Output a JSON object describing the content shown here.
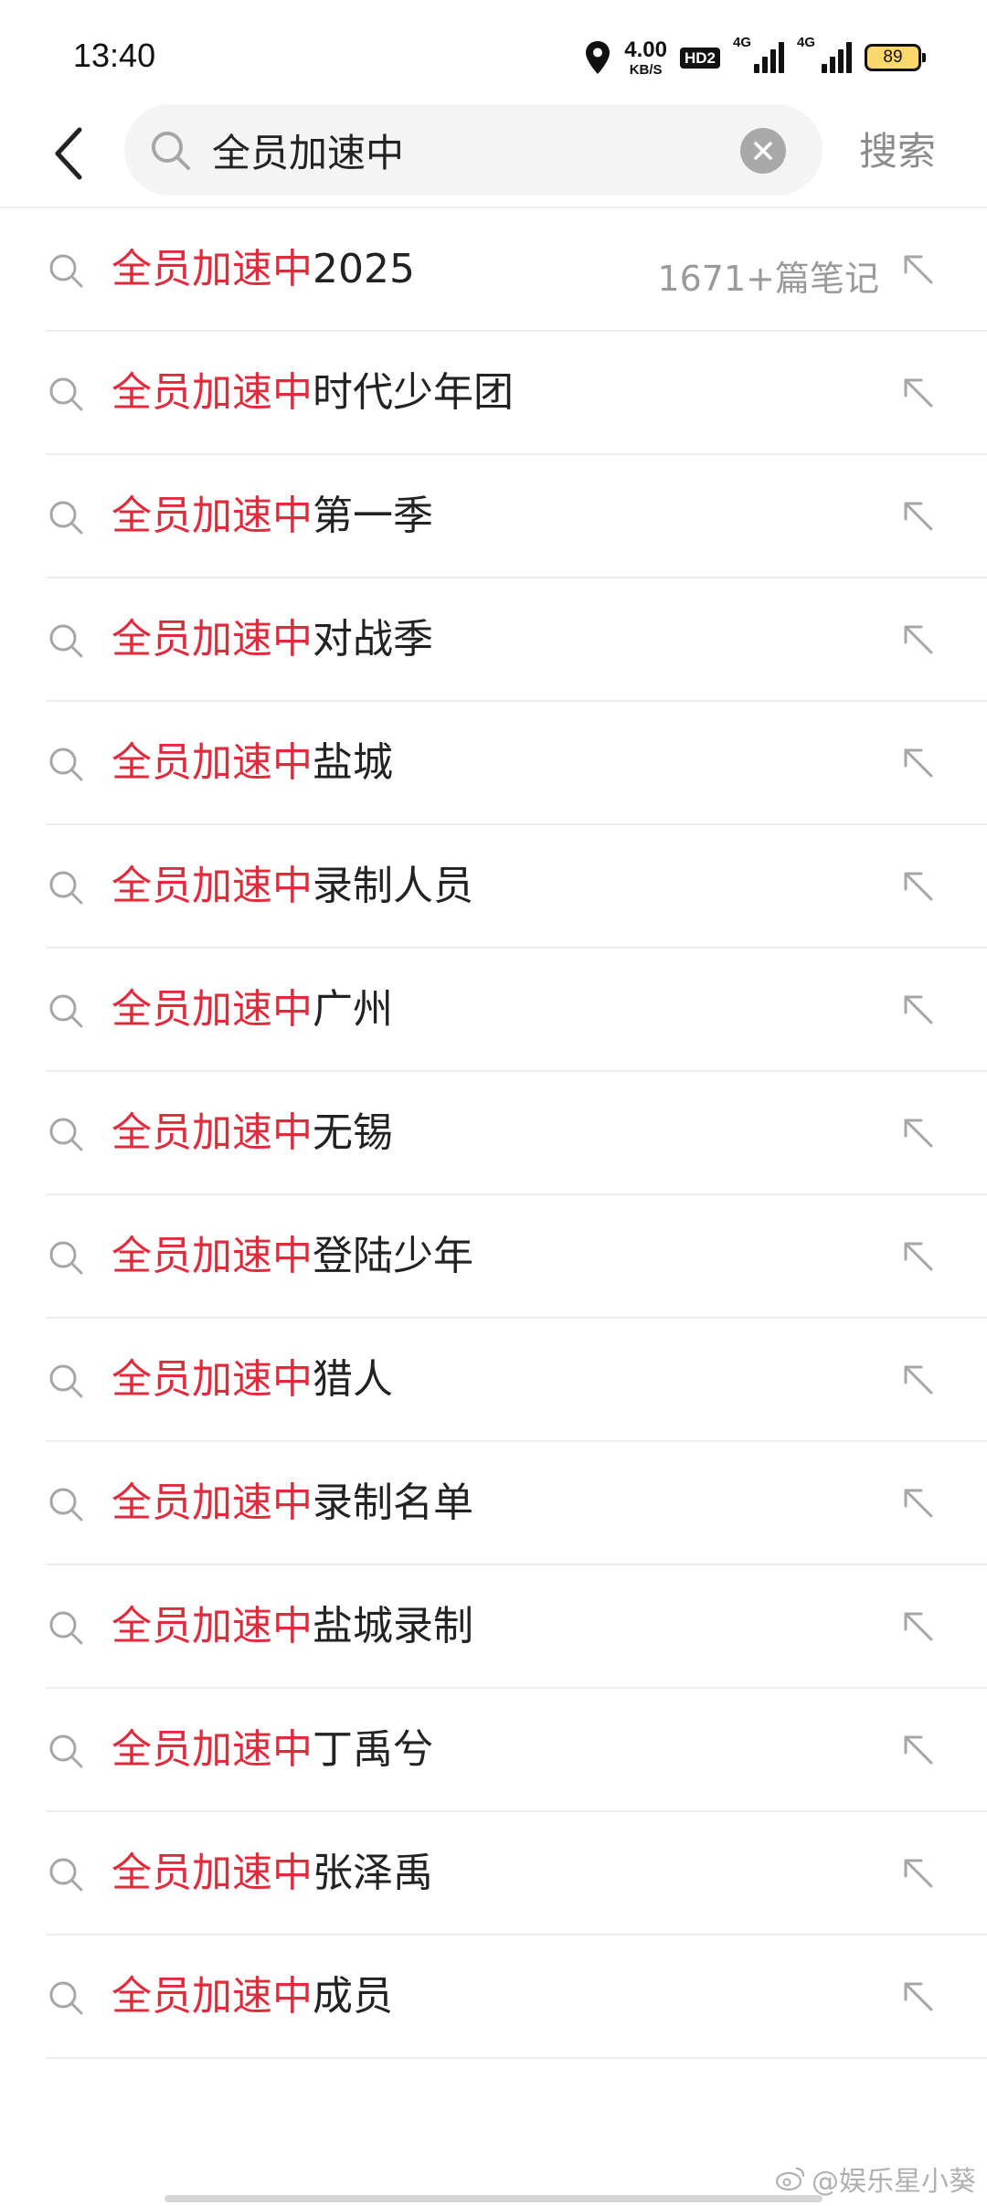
{
  "status_bar": {
    "time": "13:40",
    "net_speed_value": "4.00",
    "net_speed_unit": "KB/S",
    "hd_label": "HD2",
    "signal1_label": "4G",
    "signal2_label": "4G",
    "battery": "89",
    "battery_color": "#fbd86b"
  },
  "search": {
    "query": "全员加速中",
    "search_button_label": "搜索"
  },
  "colors": {
    "highlight": "#e02b3c",
    "text": "#222222",
    "muted": "#9a9a9a"
  },
  "suggestions": [
    {
      "highlight": "全员加速中",
      "rest": "2025",
      "count": "1671+篇笔记"
    },
    {
      "highlight": "全员加速中",
      "rest": "时代少年团"
    },
    {
      "highlight": "全员加速中",
      "rest": "第一季"
    },
    {
      "highlight": "全员加速中",
      "rest": "对战季"
    },
    {
      "highlight": "全员加速中",
      "rest": "盐城"
    },
    {
      "highlight": "全员加速中",
      "rest": "录制人员"
    },
    {
      "highlight": "全员加速中",
      "rest": "广州"
    },
    {
      "highlight": "全员加速中",
      "rest": "无锡"
    },
    {
      "highlight": "全员加速中",
      "rest": "登陆少年"
    },
    {
      "highlight": "全员加速中",
      "rest": "猎人"
    },
    {
      "highlight": "全员加速中",
      "rest": "录制名单"
    },
    {
      "highlight": "全员加速中",
      "rest": "盐城录制"
    },
    {
      "highlight": "全员加速中",
      "rest": "丁禹兮"
    },
    {
      "highlight": "全员加速中",
      "rest": "张泽禹"
    },
    {
      "highlight": "全员加速中",
      "rest": "成员"
    }
  ],
  "watermark": "@娱乐星小葵"
}
